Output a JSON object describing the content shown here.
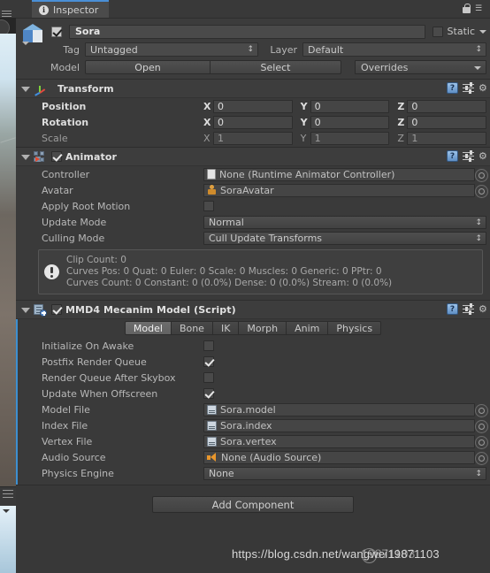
{
  "window": {
    "tab_label": "Inspector",
    "tab_icon": "info-icon",
    "lock_icon": "lock-icon",
    "menu_icon": "tab-menu-icon"
  },
  "header": {
    "enabled": true,
    "name": "Sora",
    "static_label": "Static",
    "static_checked": false,
    "tag_label": "Tag",
    "tag_value": "Untagged",
    "layer_label": "Layer",
    "layer_value": "Default",
    "model_label": "Model",
    "open_button": "Open",
    "select_button": "Select",
    "overrides_button": "Overrides"
  },
  "transform": {
    "title": "Transform",
    "rows": [
      {
        "label": "Position",
        "bold": true,
        "x": "0",
        "y": "0",
        "z": "0"
      },
      {
        "label": "Rotation",
        "bold": true,
        "x": "0",
        "y": "0",
        "z": "0"
      },
      {
        "label": "Scale",
        "bold": false,
        "x": "1",
        "y": "1",
        "z": "1"
      }
    ],
    "axis_x": "X",
    "axis_y": "Y",
    "axis_z": "Z",
    "help_icon": "help-book-icon",
    "preset_icon": "preset-sliders-icon",
    "gear_icon": "gear-icon"
  },
  "animator": {
    "title": "Animator",
    "enabled": true,
    "controller_label": "Controller",
    "controller_value": "None (Runtime Animator Controller)",
    "avatar_label": "Avatar",
    "avatar_value": "SoraAvatar",
    "apply_root_motion_label": "Apply Root Motion",
    "apply_root_motion_checked": false,
    "update_mode_label": "Update Mode",
    "update_mode_value": "Normal",
    "culling_mode_label": "Culling Mode",
    "culling_mode_value": "Cull Update Transforms",
    "info_line1": "Clip Count: 0",
    "info_line2": "Curves Pos: 0 Quat: 0 Euler: 0 Scale: 0 Muscles: 0 Generic: 0 PPtr: 0",
    "info_line3": "Curves Count: 0 Constant: 0 (0.0%) Dense: 0 (0.0%) Stream: 0 (0.0%)"
  },
  "mmd": {
    "title": "MMD4 Mecanim Model (Script)",
    "enabled": true,
    "tabs": [
      {
        "label": "Model",
        "active": true
      },
      {
        "label": "Bone",
        "active": false
      },
      {
        "label": "IK",
        "active": false
      },
      {
        "label": "Morph",
        "active": false
      },
      {
        "label": "Anim",
        "active": false
      },
      {
        "label": "Physics",
        "active": false
      }
    ],
    "toggles": [
      {
        "label": "Initialize On Awake",
        "checked": false
      },
      {
        "label": "Postfix Render Queue",
        "checked": true
      },
      {
        "label": "Render Queue After Skybox",
        "checked": false
      },
      {
        "label": "Update When Offscreen",
        "checked": true
      }
    ],
    "objects": [
      {
        "label": "Model File",
        "value": "Sora.model",
        "icon": "model-file-icon"
      },
      {
        "label": "Index File",
        "value": "Sora.index",
        "icon": "index-file-icon"
      },
      {
        "label": "Vertex File",
        "value": "Sora.vertex",
        "icon": "vertex-file-icon"
      },
      {
        "label": "Audio Source",
        "value": "None (Audio Source)",
        "icon": "audio-source-icon"
      }
    ],
    "physics_engine_label": "Physics Engine",
    "physics_engine_value": "None"
  },
  "footer": {
    "add_component": "Add Component"
  },
  "watermark": {
    "url": "https://blog.csdn.net/wangwei19871103",
    "overlay": "19871103"
  },
  "colors": {
    "panel_bg": "#383838",
    "accent_blue": "#3d8fd1",
    "field_bg": "#454545",
    "text": "#b4b4b4"
  }
}
